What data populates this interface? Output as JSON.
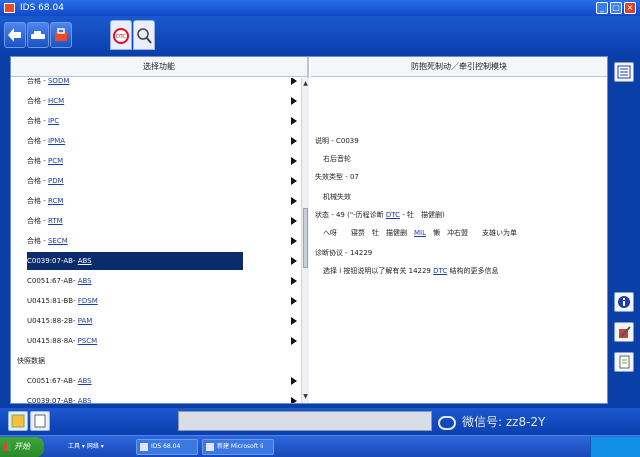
{
  "window": {
    "title": "IDS 68.04"
  },
  "toolbar": {
    "tab_dtc": "DTC"
  },
  "left_pane": {
    "header": "选择功能",
    "items": [
      {
        "prefix": "合格 - ",
        "link": "SODM",
        "selected": false,
        "heading": false
      },
      {
        "prefix": "合格 - ",
        "link": "HCM",
        "selected": false,
        "heading": false
      },
      {
        "prefix": "合格 - ",
        "link": "IPC",
        "selected": false,
        "heading": false
      },
      {
        "prefix": "合格 - ",
        "link": "IPMA",
        "selected": false,
        "heading": false
      },
      {
        "prefix": "合格 - ",
        "link": "PCM",
        "selected": false,
        "heading": false
      },
      {
        "prefix": "合格 - ",
        "link": "PDM",
        "selected": false,
        "heading": false
      },
      {
        "prefix": "合格 - ",
        "link": "RCM",
        "selected": false,
        "heading": false
      },
      {
        "prefix": "合格 - ",
        "link": "RTM",
        "selected": false,
        "heading": false
      },
      {
        "prefix": "合格 - ",
        "link": "SECM",
        "selected": false,
        "heading": false
      },
      {
        "prefix": "C0039:07-AB- ",
        "link": "ABS",
        "selected": true,
        "heading": false
      },
      {
        "prefix": "C0051:67-AB- ",
        "link": "ABS",
        "selected": false,
        "heading": false
      },
      {
        "prefix": "U0415:81-BB- ",
        "link": "FDSM",
        "selected": false,
        "heading": false
      },
      {
        "prefix": "U0415:88-2B- ",
        "link": "PAM",
        "selected": false,
        "heading": false
      },
      {
        "prefix": "U0415:88-8A- ",
        "link": "PSCM",
        "selected": false,
        "heading": false
      },
      {
        "prefix": "快照数据",
        "link": "",
        "selected": false,
        "heading": true
      },
      {
        "prefix": "C0051:67-AB- ",
        "link": "ABS",
        "selected": false,
        "heading": false
      },
      {
        "prefix": "C0039:07-AB- ",
        "link": "ABS",
        "selected": false,
        "heading": false
      }
    ]
  },
  "right_pane": {
    "header": "防抱死制动／牵引控制模块",
    "lines": [
      {
        "text": "说明 - C0039",
        "link": "",
        "suffix": "",
        "indent": false
      },
      {
        "text": "右后音轮",
        "link": "",
        "suffix": "",
        "indent": true
      },
      {
        "text": "失效类型 - 07",
        "link": "",
        "suffix": "",
        "indent": false
      },
      {
        "text": "机械失效",
        "link": "",
        "suffix": "",
        "indent": true
      },
      {
        "text": "状态 - 49 (\"-历程诊断 ",
        "link": "DTC",
        "suffix": " - 牡　描健删)",
        "indent": false
      },
      {
        "text": "ヘ呀　　寝赘　牡　描健删　",
        "link": "MIL",
        "suffix": "　懒　冲右盟　　支雄い为单",
        "indent": true
      },
      {
        "text": "诊断协议 - 14229",
        "link": "",
        "suffix": "",
        "indent": false
      },
      {
        "text": "选择 i 按钮说明以了解有关 14229 ",
        "link": "DTC",
        "suffix": " 结构的更多信息",
        "indent": true
      }
    ]
  },
  "watermark": {
    "text": "微信号: zz8-2Y"
  },
  "taskbar": {
    "start_label": "开始",
    "tray_label": "工具 ▾  网络 ▾",
    "task1": "IDS 68.04",
    "task2": "新建 Microsoft Ii"
  },
  "colors": {
    "selection": "#0b2c6b",
    "link": "#1a3fa8",
    "frame": "#0a3fa8"
  }
}
